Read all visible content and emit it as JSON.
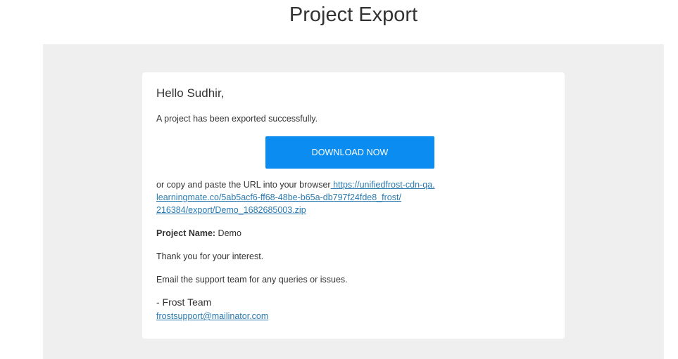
{
  "page": {
    "title": "Project Export"
  },
  "email": {
    "greeting": "Hello Sudhir,",
    "intro": "A project has been exported successfully.",
    "download_button_label": "DOWNLOAD NOW",
    "copy_prompt": "or copy and paste the URL into your browser",
    "export_url_line1": " https://unifiedfrost-cdn-qa.",
    "export_url_line2": "learningmate.co/5ab5acf6-ff68-48be-b65a-db797f24fde8_frost/",
    "export_url_line3": "216384/export/Demo_1682685003.zip",
    "project_name_label": "Project Name:",
    "project_name_value": "Demo",
    "thanks": "Thank you for your interest.",
    "support_note": "Email the support team for any queries or issues.",
    "signoff": "- Frost Team",
    "support_email": "frostsupport@mailinator.com"
  },
  "colors": {
    "button": "#0a8cf0",
    "link": "#2a7ab0",
    "backdrop": "#efefef"
  }
}
